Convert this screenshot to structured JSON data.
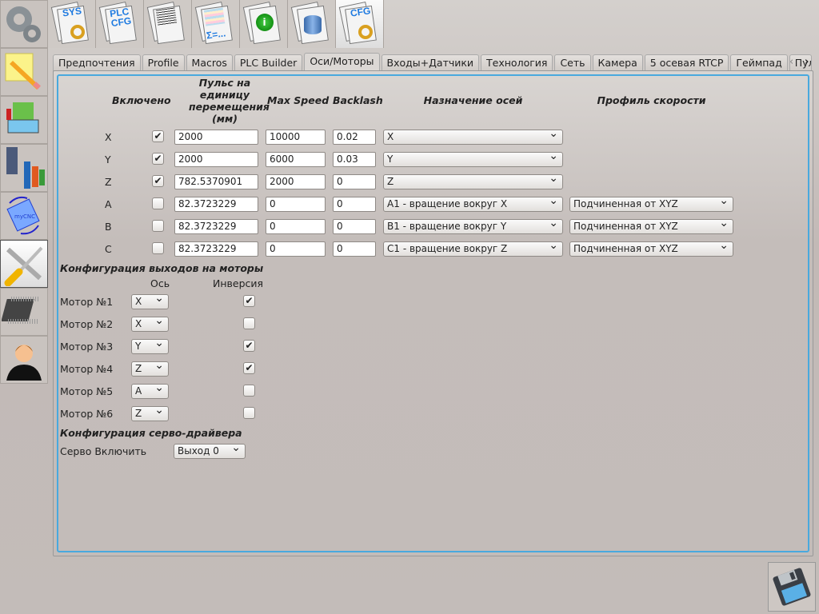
{
  "sidebar": {
    "items": [
      {
        "name": "settings-gears-icon"
      },
      {
        "name": "notes-pencil-icon"
      },
      {
        "name": "books-icon"
      },
      {
        "name": "tool-statistics-icon"
      },
      {
        "name": "mycnc-rotate-icon"
      },
      {
        "name": "tools-wrench-screwdriver-icon",
        "active": true
      },
      {
        "name": "chip-icon"
      },
      {
        "name": "user-icon"
      }
    ]
  },
  "toolbar": {
    "items": [
      {
        "name": "sys-config-icon",
        "label": "SYS",
        "gear": true
      },
      {
        "name": "plc-config-icon",
        "label": "PLC CFG"
      },
      {
        "name": "text-document-icon",
        "label": ""
      },
      {
        "name": "variables-table-icon",
        "label": "Σ=..."
      },
      {
        "name": "info-icon",
        "label": ""
      },
      {
        "name": "database-icon",
        "label": ""
      },
      {
        "name": "cfg-icon",
        "label": "CFG",
        "gear": true,
        "active": true
      }
    ]
  },
  "tabs": [
    "Предпочтения",
    "Profile",
    "Macros",
    "PLC Builder",
    "Оси/Моторы",
    "Входы+Датчики",
    "Технология",
    "Сеть",
    "Камера",
    "5 осевая RTCP",
    "Геймпад",
    "Пул"
  ],
  "active_tab": 4,
  "axes": {
    "headers": {
      "enabled": "Включено",
      "pulse": "Пульс на единицу перемещения (мм)",
      "max_speed": "Max Speed",
      "backlash": "Backlash",
      "assign": "Назначение осей",
      "profile": "Профиль скорости"
    },
    "rows": [
      {
        "axis": "X",
        "enabled": true,
        "pulse": "2000",
        "max_speed": "10000",
        "backlash": "0.02",
        "assign": "X",
        "profile": null
      },
      {
        "axis": "Y",
        "enabled": true,
        "pulse": "2000",
        "max_speed": "6000",
        "backlash": "0.03",
        "assign": "Y",
        "profile": null
      },
      {
        "axis": "Z",
        "enabled": true,
        "pulse": "782.5370901",
        "max_speed": "2000",
        "backlash": "0",
        "assign": "Z",
        "profile": null
      },
      {
        "axis": "A",
        "enabled": false,
        "pulse": "82.3723229",
        "max_speed": "0",
        "backlash": "0",
        "assign": "A1 - вращение вокруг X",
        "profile": "Подчиненная от XYZ"
      },
      {
        "axis": "B",
        "enabled": false,
        "pulse": "82.3723229",
        "max_speed": "0",
        "backlash": "0",
        "assign": "B1 - вращение вокруг Y",
        "profile": "Подчиненная от XYZ"
      },
      {
        "axis": "C",
        "enabled": false,
        "pulse": "82.3723229",
        "max_speed": "0",
        "backlash": "0",
        "assign": "C1 - вращение вокруг Z",
        "profile": "Подчиненная от XYZ"
      }
    ]
  },
  "motors": {
    "title": "Конфигурация выходов на моторы",
    "col_axis": "Ось",
    "col_invert": "Инверсия",
    "rows": [
      {
        "label": "Мотор №1",
        "axis": "X",
        "invert": true
      },
      {
        "label": "Мотор №2",
        "axis": "X",
        "invert": false
      },
      {
        "label": "Мотор №3",
        "axis": "Y",
        "invert": true
      },
      {
        "label": "Мотор №4",
        "axis": "Z",
        "invert": true
      },
      {
        "label": "Мотор №5",
        "axis": "A",
        "invert": false
      },
      {
        "label": "Мотор №6",
        "axis": "Z",
        "invert": false
      }
    ]
  },
  "servo": {
    "title": "Конфигурация серво-драйвера",
    "label": "Серво Включить",
    "value": "Выход 0"
  },
  "save_icon": "floppy-save-icon"
}
